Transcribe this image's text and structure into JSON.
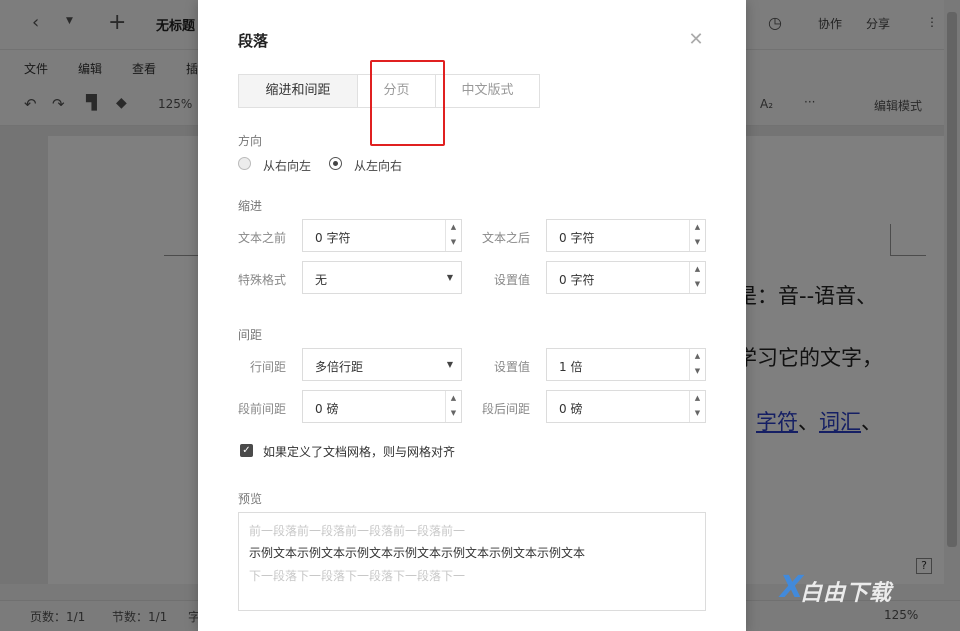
{
  "app": {
    "doc_title": "无标题",
    "top_actions": {
      "collab": "协作",
      "share": "分享",
      "more": "⋮"
    },
    "menu": [
      "文件",
      "编辑",
      "查看",
      "插"
    ],
    "zoom": "125%",
    "edit_mode": "编辑模式",
    "subscript": "A₂",
    "doc_lines": [
      "是：音--语音、",
      "学习它的文字，"
    ],
    "doc_link_line": {
      "link1": "字符",
      "sep": "、",
      "link2": "词汇",
      "tail": "、"
    },
    "status": {
      "pages": "页数：1/1",
      "sections": "节数：1/1",
      "chars": "字",
      "zoom": "125%"
    },
    "help": "?"
  },
  "dialog": {
    "title": "段落",
    "tabs": [
      {
        "label": "缩进和间距",
        "active": true
      },
      {
        "label": "分页",
        "active": false
      },
      {
        "label": "中文版式",
        "active": false
      }
    ],
    "direction": {
      "heading": "方向",
      "rtl": "从右向左",
      "ltr": "从左向右",
      "selected": "ltr"
    },
    "indent": {
      "heading": "缩进",
      "before_label": "文本之前",
      "before_value": "0 字符",
      "after_label": "文本之后",
      "after_value": "0 字符",
      "special_label": "特殊格式",
      "special_value": "无",
      "special_set_label": "设置值",
      "special_set_value": "0 字符"
    },
    "spacing": {
      "heading": "间距",
      "line_label": "行间距",
      "line_value": "多倍行距",
      "line_set_label": "设置值",
      "line_set_value": "1 倍",
      "before_label": "段前间距",
      "before_value": "0 磅",
      "after_label": "段后间距",
      "after_value": "0 磅"
    },
    "grid_checkbox": {
      "label": "如果定义了文档网格，则与网格对齐",
      "checked": true
    },
    "preview": {
      "heading": "预览",
      "prev_line": "前一段落前一段落前一段落前一段落前一",
      "sample_line": "示例文本示例文本示例文本示例文本示例文本示例文本示例文本",
      "next_line": "下一段落下一段落下一段落下一段落下一"
    }
  },
  "watermark": "白由下载"
}
